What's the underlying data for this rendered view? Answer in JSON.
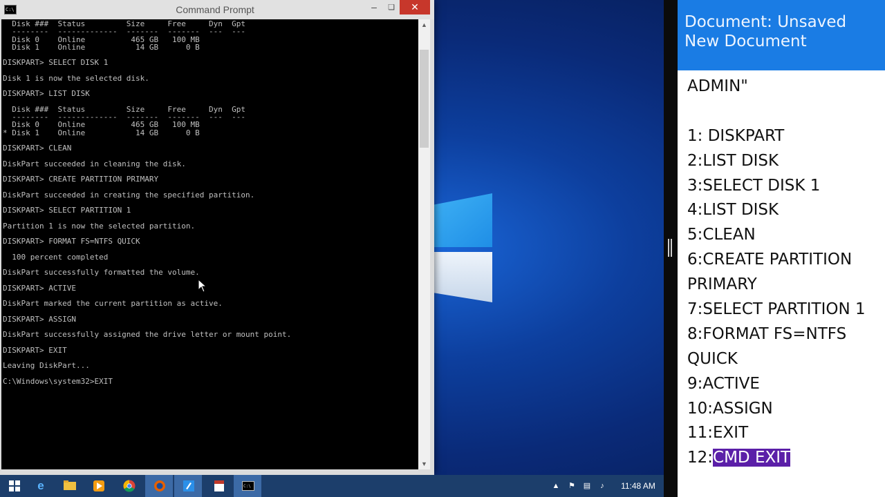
{
  "cmd": {
    "title": "Command Prompt",
    "lines": [
      "  Disk ###  Status         Size     Free     Dyn  Gpt",
      "  --------  -------------  -------  -------  ---  ---",
      "  Disk 0    Online          465 GB   100 MB",
      "  Disk 1    Online           14 GB      0 B",
      "",
      "DISKPART> SELECT DISK 1",
      "",
      "Disk 1 is now the selected disk.",
      "",
      "DISKPART> LIST DISK",
      "",
      "  Disk ###  Status         Size     Free     Dyn  Gpt",
      "  --------  -------------  -------  -------  ---  ---",
      "  Disk 0    Online          465 GB   100 MB",
      "* Disk 1    Online           14 GB      0 B",
      "",
      "DISKPART> CLEAN",
      "",
      "DiskPart succeeded in cleaning the disk.",
      "",
      "DISKPART> CREATE PARTITION PRIMARY",
      "",
      "DiskPart succeeded in creating the specified partition.",
      "",
      "DISKPART> SELECT PARTITION 1",
      "",
      "Partition 1 is now the selected partition.",
      "",
      "DISKPART> FORMAT FS=NTFS QUICK",
      "",
      "  100 percent completed",
      "",
      "DiskPart successfully formatted the volume.",
      "",
      "DISKPART> ACTIVE",
      "",
      "DiskPart marked the current partition as active.",
      "",
      "DISKPART> ASSIGN",
      "",
      "DiskPart successfully assigned the drive letter or mount point.",
      "",
      "DISKPART> EXIT",
      "",
      "Leaving DiskPart...",
      "",
      "C:\\Windows\\system32>EXIT"
    ]
  },
  "document": {
    "title": "Document: Unsaved New Document",
    "lines": [
      "ADMIN\"",
      "",
      "1: DISKPART",
      "2:LIST DISK",
      "3:SELECT DISK 1",
      "4:LIST DISK",
      "5:CLEAN",
      "6:CREATE PARTITION",
      "PRIMARY",
      "7:SELECT PARTITION 1",
      "8:FORMAT FS=NTFS",
      "QUICK",
      "9:ACTIVE",
      "10:ASSIGN",
      "11:EXIT"
    ],
    "last_prefix": "12:",
    "last_selected": "CMD EXIT",
    "selection_color": "#5b1fa8",
    "header_color": "#1a7ce4"
  },
  "taskbar": {
    "clock": "11:48 AM",
    "apps": [
      "windows-start-icon",
      "internet-explorer-icon",
      "file-explorer-icon",
      "media-player-icon",
      "chrome-icon",
      "firefox-icon",
      "notepad-icon",
      "pdf-viewer-icon",
      "command-prompt-icon"
    ],
    "tray": [
      "chevron-up-icon",
      "flag-icon",
      "network-icon",
      "volume-icon",
      "keyboard-icon"
    ]
  }
}
